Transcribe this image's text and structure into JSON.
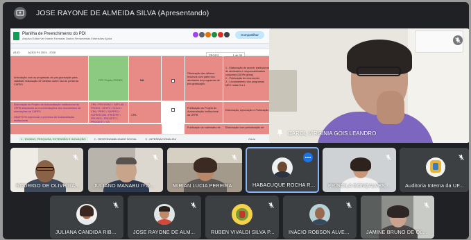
{
  "presenter_banner": "JOSE RAYONE DE ALMEIDA SILVA (Apresentando)",
  "shared_screen": {
    "doc_title": "Planilha de Preenchimento do PDI",
    "menu": "Arquivo  Editar  Ver  Inserir  Formatar  Dados  Ferramentas  Extensões  Ajuda",
    "share_label": "Compartilhar",
    "cell_ref": "A143",
    "formula": "AÇÃO P4 2024 - 2028",
    "overlay": [
      "PROPG",
      "1 de 35"
    ],
    "cells": {
      "c1": "Articulação com os programas de pós-graduação para viabilizar realocação de créditos sobre uso do portal da CAPES",
      "c2": "PPF Projeto PROEX",
      "c3": "NA",
      "c4": "Otimização dos últimos recursos com parte dos atividades da programas de pós-graduação",
      "c5": "1 - Elaboração de acordo institucional de atividades e responsabilidades conjuntas (DE/Projetos)\n2 - Publicação de documento\n3 - Levantamento dos programas MEC notas 3 a 4",
      "c6": "Elaboração do Projeto de Autoavaliação Institucional da UFPB adaptando as recomendações dos documentos de orientações da CAPES",
      "c7": "CPA / PROGRAD / DEPLAD / PROEX / DINFO / SUCO / CPA / PRPG / SAPPES / SUPERCOM / PRGEPE / PROAES / PROJETO / PROGEST / CS",
      "c8": "CPA",
      "c9": "Publicação do Projeto de Autoavaliação Institucional da UFPB",
      "c10": "Elaboração, Aprovação e Publicação",
      "c11": "OBJETIVO: Aprimorar o processo de Autoavaliação Institucional",
      "c12": "Publicação do calendário de",
      "c13": "Elaboração com periodização de"
    },
    "tabs": [
      "1 - ENSINO, PESQUISA, EXTENSÃO E INOVAÇÃO",
      "2 - RESPONSABILIDADE SOCIAL",
      "3 - INTERNACIONALIZA",
      "Gérid"
    ]
  },
  "main_speaker": {
    "name": "CAROL VIRGINIA GOIS LEANDRO"
  },
  "participants": [
    {
      "name": "RODRIGO DE OLIVEIRA...",
      "muted": true
    },
    {
      "name": "JULIANO MANABU IYO...",
      "muted": true
    },
    {
      "name": "MIRIAN LUCIA PEREIRA",
      "muted": true
    },
    {
      "name": "HABACUQUE ROCHA R...",
      "muted": false
    },
    {
      "name": "PRISCILA GONÇALVES...",
      "muted": true
    },
    {
      "name": "Auditoria Interna da UF...",
      "muted": true
    },
    {
      "name": "JULIANA CANDIDA RIB...",
      "muted": true
    },
    {
      "name": "JOSE RAYONE DE ALM...",
      "muted": true
    },
    {
      "name": "RUBEN VIVALDI SILVA P...",
      "muted": true
    },
    {
      "name": "INÁCIO ROBSON ALVE...",
      "muted": true
    },
    {
      "name": "JAMINE BRUNO DE OL...",
      "muted": true
    }
  ],
  "colors": {
    "background": "#202124",
    "tile": "#3c4043",
    "active_border": "#8ab4f8",
    "sheet_red": "#e88b87",
    "sheet_green": "#8cc981"
  }
}
